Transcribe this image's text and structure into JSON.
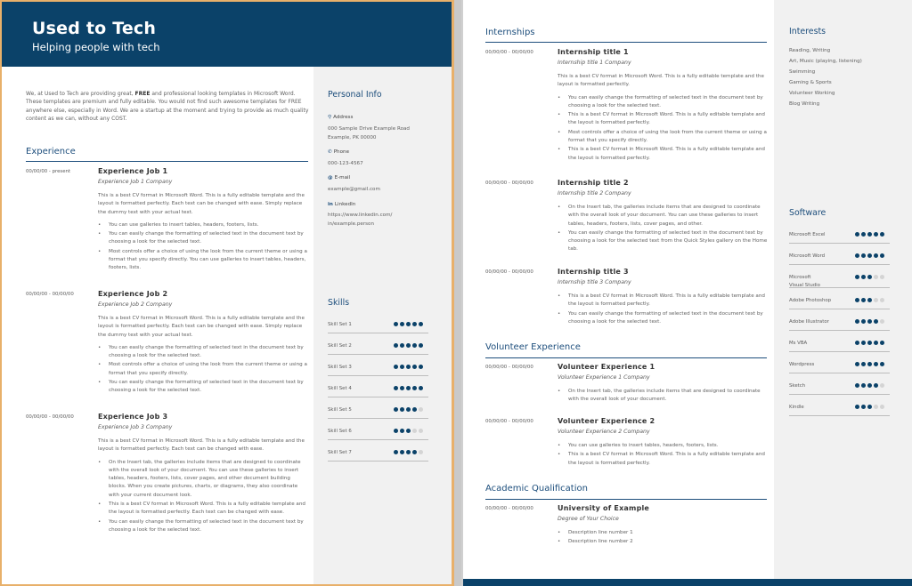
{
  "page1": {
    "header": {
      "title": "Used to Tech",
      "subtitle": "Helping people with tech"
    },
    "intro": {
      "before": "We, at Used to Tech are providing great, ",
      "bold": "FREE",
      "after": " and professional looking templates in Microsoft Word. These templates are premium and fully editable. You would not find such awesome templates for FREE anywhere else, especially in Word. We are a startup at the moment and trying to provide as much quality content as we can, without any COST."
    },
    "experience": {
      "title": "Experience",
      "entries": [
        {
          "dates": "00/00/00 - present",
          "title": "Experience Job 1",
          "company": "Experience  Job 1 Company",
          "desc": "This is a best CV format in Microsoft Word. This is a fully editable template and the layout is formatted perfectly. Each text can be changed with ease. Simply replace the dummy text with your actual text.",
          "bullets": [
            "You can use galleries to insert tables, headers, footers, lists.",
            "You can easily change the formatting of selected text in the document text by choosing a look for the selected text.",
            "Most controls offer a choice of using the look from the current theme or using a format that you specify directly.  You can use galleries to insert tables, headers, footers, lists."
          ]
        },
        {
          "dates": "00/00/00 - 00/00/00",
          "title": "Experience Job 2",
          "company": "Experience  Job 2 Company",
          "desc": "This is a best CV format in Microsoft Word. This is a fully editable template and the layout is formatted perfectly. Each text can be changed with ease. Simply replace the dummy text with your actual text.",
          "bullets": [
            "You can easily change the formatting of selected text in the document text by choosing a look for the selected text.",
            "Most controls offer a choice of using the look from the current theme or using a format that you specify directly.",
            "You can easily change the formatting of selected text in the document text by choosing a look for the selected text."
          ]
        },
        {
          "dates": "00/00/00 - 00/00/00",
          "title": "Experience Job 3",
          "company": "Experience  Job 3 Company",
          "desc": "This is a best CV format in Microsoft Word. This is a fully editable template and the layout is formatted perfectly. Each text can be changed with ease.",
          "bullets": [
            "On the Insert tab, the galleries include items that are designed to coordinate with the overall look of your document. You can use these galleries to insert tables, headers, footers, lists, cover pages, and other document building blocks. When you create pictures, charts, or diagrams, they also coordinate with your current document look.",
            "This is a best CV format in Microsoft Word. This is a fully editable template and the layout is formatted perfectly. Each text can be changed with ease.",
            "You can easily change the formatting of selected text in the document text by choosing a look for the selected text."
          ]
        }
      ]
    },
    "personal_info": {
      "title": "Personal Info",
      "address_label": "Address",
      "address_line1": "000 Sample Drive Example Road",
      "address_line2": "Example, PK 00000",
      "phone_label": "Phone",
      "phone": "000-123-4567",
      "email_label": "E-mail",
      "email": "example@gmail.com",
      "linkedin_label": "LinkedIn",
      "linkedin_line1": "https://www.linkedin.com/",
      "linkedin_line2": "in/example.person",
      "icons": {
        "address": "⚲",
        "phone": "✆",
        "email": "@",
        "linkedin": "in"
      }
    },
    "skills": {
      "title": "Skills",
      "max": 5,
      "items": [
        {
          "name": "Skill Set 1",
          "rating": 5
        },
        {
          "name": "Skill Set 2",
          "rating": 5
        },
        {
          "name": "Skill Set 3",
          "rating": 5
        },
        {
          "name": "Skill Set 4",
          "rating": 5
        },
        {
          "name": "Skill Set 5",
          "rating": 4
        },
        {
          "name": "Skill Set 6",
          "rating": 3
        },
        {
          "name": "Skill Set 7",
          "rating": 4
        }
      ]
    }
  },
  "page2": {
    "internships": {
      "title": "Internships",
      "entries": [
        {
          "dates": "00/00/00 - 00/00/00",
          "title": "Internship title 1",
          "company": "Internship   title  1 Company",
          "desc": "This is a best CV format in Microsoft Word. This is a fully editable template and the layout is formatted perfectly.",
          "bullets": [
            "You can easily change the formatting of selected text in the document text by choosing a look for the selected text.",
            "This is a best CV format in Microsoft Word. This is a fully editable template and the layout is formatted perfectly.",
            "Most controls offer a choice of using the look from the current theme or using a format that you specify directly.",
            "This is a best CV format in Microsoft Word. This is a fully editable template and the layout is formatted perfectly."
          ]
        },
        {
          "dates": "00/00/00 - 00/00/00",
          "title": "Internship title 2",
          "company": "Internship   title  2 Company",
          "desc": "",
          "bullets": [
            "On the Insert tab, the galleries include items that are designed to coordinate with the overall look of your document.  You can use these galleries to insert tables, headers, footers, lists, cover pages, and other.",
            "You can easily change the formatting of selected text in the document text by choosing a look for the selected text from the Quick Styles gallery on the Home tab."
          ]
        },
        {
          "dates": "00/00/00 - 00/00/00",
          "title": "Internship title 3",
          "company": "Internship   title  3 Company",
          "desc": "",
          "bullets": [
            "This is a best CV format in Microsoft Word. This is a fully editable template and the layout is formatted perfectly.",
            "You can easily change the formatting of selected text in the document text by choosing a look for the selected text."
          ]
        }
      ]
    },
    "volunteer": {
      "title": "Volunteer Experience",
      "entries": [
        {
          "dates": "00/00/00 - 00/00/00",
          "title": "Volunteer Experience 1",
          "company": "Volunteer  Experience  1 Company",
          "desc": "",
          "bullets": [
            "On the Insert tab, the galleries include items that are designed to coordinate with the overall look of your document."
          ]
        },
        {
          "dates": "00/00/00 - 00/00/00",
          "title": "Volunteer Experience 2",
          "company": "Volunteer  Experience  2 Company",
          "desc": "",
          "bullets": [
            "You can use galleries to insert tables, headers, footers, lists.",
            "This is a best CV format in Microsoft Word. This is a fully editable template and the layout is formatted perfectly."
          ]
        }
      ]
    },
    "academic": {
      "title": "Academic Qualification",
      "entries": [
        {
          "dates": "00/00/00 - 00/00/00",
          "title": "University of Example",
          "company": "Degree  of  Your  Choice",
          "desc": "",
          "bullets": [
            "Description line number 1",
            "Description line number 2"
          ]
        }
      ]
    },
    "interests": {
      "title": "Interests",
      "items": [
        "Reading, Writing",
        "Art, Music (playing, listening)",
        "Swimming",
        "Gaming & Sports",
        "Volunteer Working",
        "Blog Writing"
      ]
    },
    "software": {
      "title": "Software",
      "max": 5,
      "items": [
        {
          "name": "Microsoft Excel",
          "rating": 5
        },
        {
          "name": "Microsoft Word",
          "rating": 5
        },
        {
          "name": "Microsoft\nVisual Studio",
          "rating": 3
        },
        {
          "name": "Adobe Photoshop",
          "rating": 3
        },
        {
          "name": "Adobe Illustrator",
          "rating": 4
        },
        {
          "name": "Ms VBA",
          "rating": 5
        },
        {
          "name": "Wordpress",
          "rating": 5
        },
        {
          "name": "Sketch",
          "rating": 4
        },
        {
          "name": "Kindle",
          "rating": 3
        }
      ]
    }
  },
  "colors": {
    "brand": "#0b4269",
    "heading": "#1d4e7c",
    "dot_off": "#d4d4d4",
    "sidebar": "#f1f1f1"
  }
}
